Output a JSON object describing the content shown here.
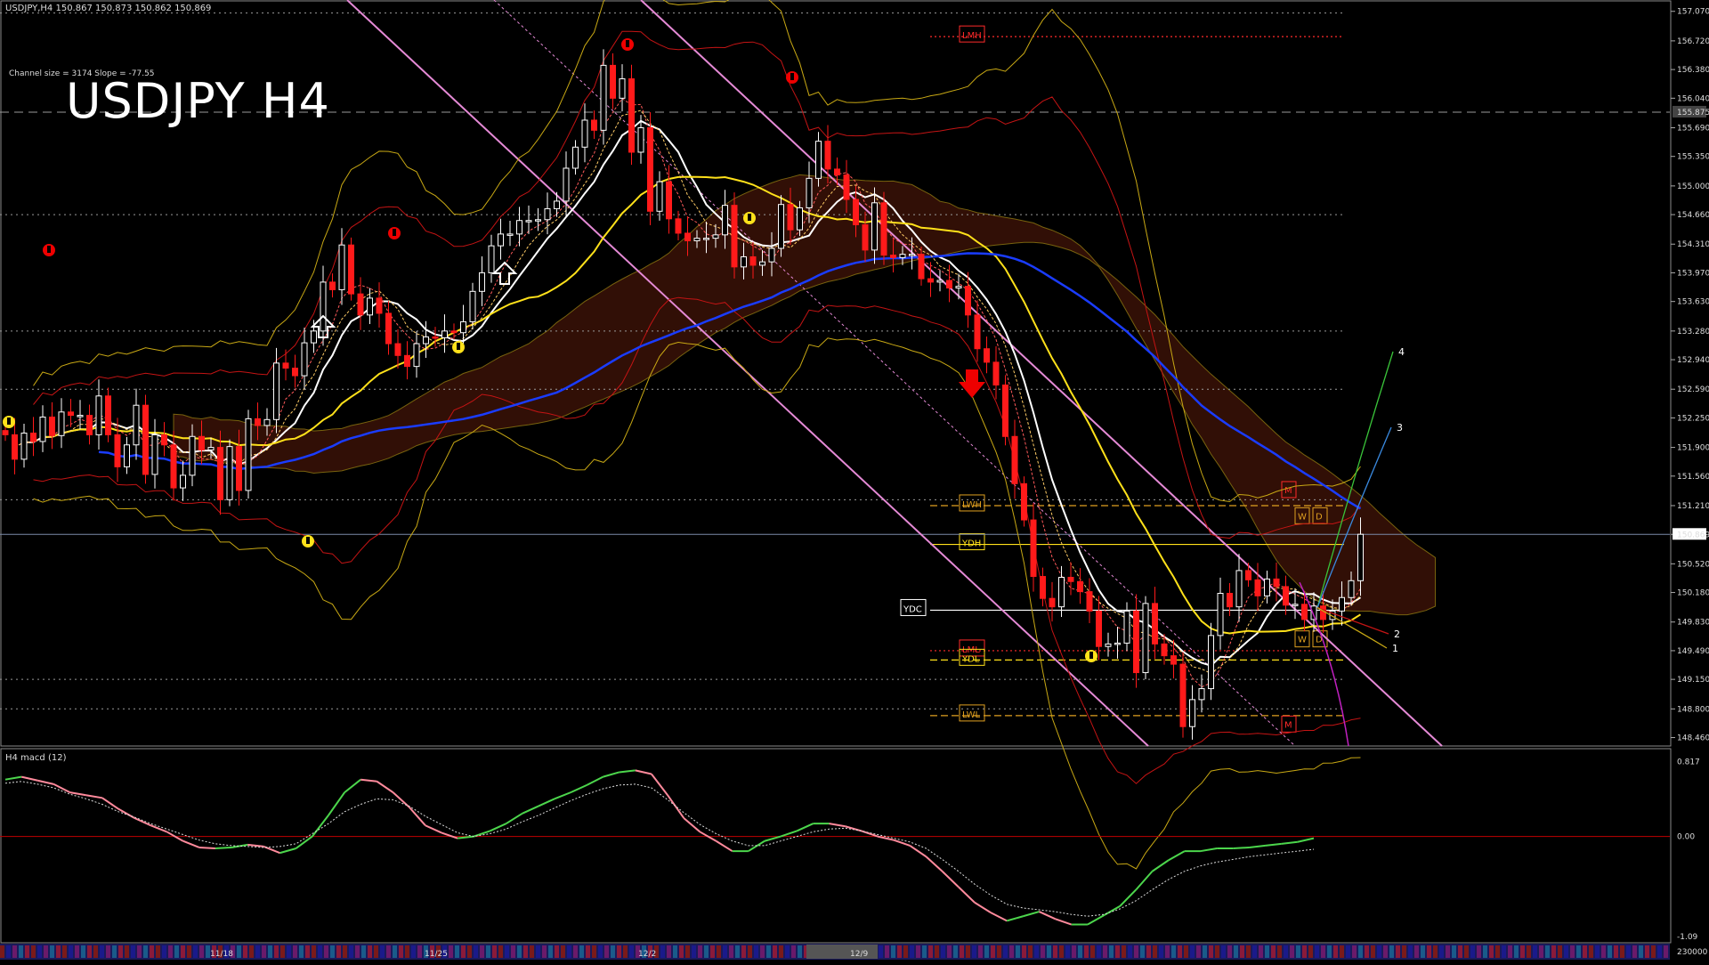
{
  "header": {
    "symbol_line": "USDJPY,H4  150.867 150.873 150.862 150.869",
    "channel_info": "Channel size = 3174 Slope = -77.55",
    "title": "USDJPY H4",
    "macd_label": "H4  macd (12)"
  },
  "colors": {
    "background": "#000000",
    "bull_candle": "#ffffff",
    "bear_candle": "#ff1a1a",
    "channel": "#e58ad6",
    "ma_white": "#ffffff",
    "ma_yellow": "#ffe11a",
    "ma_blue": "#1a3cff",
    "macd_up": "#4cd64c",
    "macd_down": "#ff8a9c",
    "signal": "#dddddd",
    "zero_line": "#c00000"
  },
  "chart_data": [
    {
      "type": "candlestick",
      "title": "USDJPY H4",
      "price_axis": {
        "ticks": [
          "157.070",
          "156.720",
          "156.380",
          "156.040",
          "155.690",
          "155.350",
          "155.000",
          "154.660",
          "154.310",
          "153.970",
          "153.630",
          "153.280",
          "152.940",
          "152.590",
          "152.250",
          "151.900",
          "151.560",
          "151.210",
          "150.869",
          "150.520",
          "150.180",
          "149.830",
          "149.490",
          "149.150",
          "148.800",
          "148.460"
        ],
        "current_price": "150.869",
        "marker_price": "155.875",
        "ylim": [
          148.36,
          157.12
        ]
      },
      "time_axis": {
        "labels": [
          "11/18",
          "11/25",
          "12/2",
          "12/9"
        ]
      },
      "close": [
        152.05,
        151.76,
        152.07,
        151.97,
        152.26,
        152.04,
        152.32,
        152.28,
        152.28,
        152.05,
        152.51,
        152.05,
        151.67,
        151.93,
        152.4,
        151.58,
        152.05,
        151.93,
        151.42,
        151.57,
        152.03,
        151.87,
        151.9,
        151.28,
        151.91,
        151.39,
        152.24,
        152.16,
        152.23,
        152.9,
        152.84,
        152.75,
        153.14,
        153.28,
        153.86,
        153.77,
        154.3,
        153.72,
        153.47,
        153.67,
        153.49,
        153.13,
        152.99,
        152.86,
        153.13,
        153.21,
        153.2,
        153.28,
        153.26,
        153.39,
        153.75,
        153.97,
        154.29,
        154.43,
        154.43,
        154.59,
        154.59,
        154.6,
        154.73,
        154.82,
        155.21,
        155.46,
        155.78,
        155.66,
        156.43,
        156.04,
        156.27,
        155.4,
        155.69,
        154.7,
        155.05,
        154.61,
        154.44,
        154.35,
        154.38,
        154.38,
        154.42,
        154.77,
        154.04,
        154.16,
        154.06,
        154.1,
        154.26,
        154.78,
        154.48,
        154.74,
        155.09,
        155.53,
        155.2,
        155.13,
        154.84,
        154.54,
        154.24,
        154.8,
        154.18,
        154.15,
        154.19,
        154.19,
        153.9,
        153.86,
        153.88,
        153.79,
        153.81,
        153.47,
        153.07,
        152.91,
        152.64,
        152.03,
        151.47,
        151.04,
        150.37,
        150.11,
        150.01,
        150.36,
        150.31,
        150.19,
        149.96,
        149.54,
        149.57,
        149.58,
        149.96,
        149.23,
        150.05,
        149.57,
        149.43,
        149.33,
        148.59,
        148.91,
        149.04,
        149.67,
        150.17,
        150.01,
        150.44,
        150.33,
        150.14,
        150.34,
        150.25,
        150.03,
        150.04,
        149.86,
        150.02,
        149.86,
        149.96,
        150.12,
        150.32,
        150.87
      ],
      "levels": [
        {
          "label": "LMH",
          "price": 156.77,
          "style": "dotted"
        },
        {
          "label": "LWH",
          "price": 151.21,
          "style": "dashed"
        },
        {
          "label": "YDH",
          "price": 150.75,
          "style": "solid"
        },
        {
          "label": "YDC",
          "price": 149.97,
          "style": "solid"
        },
        {
          "label": "LML",
          "price": 149.49,
          "style": "dotted"
        },
        {
          "label": "YDL",
          "price": 149.38,
          "style": "dashed"
        },
        {
          "label": "LWL",
          "price": 148.72,
          "style": "dashed"
        }
      ],
      "period_tags": [
        "W",
        "D",
        "W",
        "D",
        "M",
        "M"
      ],
      "projection_labels": [
        "4",
        "3",
        "2",
        "1"
      ],
      "overlays": [
        "price channel",
        "moving averages",
        "bollinger bands",
        "ichimoku cloud",
        "fractal arrows"
      ]
    },
    {
      "type": "line",
      "title": "H4 macd (12)",
      "y_ticks": [
        "0.817",
        "0.00",
        "-1.09"
      ],
      "secondary_tick": "230000",
      "ylim": [
        -1.12,
        0.85
      ],
      "macd": [
        0.62,
        0.65,
        0.61,
        0.57,
        0.48,
        0.45,
        0.42,
        0.3,
        0.2,
        0.12,
        0.05,
        -0.05,
        -0.12,
        -0.13,
        -0.12,
        -0.09,
        -0.11,
        -0.18,
        -0.13,
        0.0,
        0.23,
        0.48,
        0.62,
        0.6,
        0.48,
        0.32,
        0.12,
        0.04,
        -0.02,
        0.0,
        0.06,
        0.14,
        0.25,
        0.33,
        0.41,
        0.48,
        0.56,
        0.65,
        0.7,
        0.72,
        0.68,
        0.45,
        0.2,
        0.05,
        -0.05,
        -0.16,
        -0.16,
        -0.05,
        0.0,
        0.06,
        0.14,
        0.14,
        0.11,
        0.06,
        0.0,
        -0.04,
        -0.1,
        -0.22,
        -0.38,
        -0.55,
        -0.72,
        -0.83,
        -0.92,
        -0.87,
        -0.82,
        -0.9,
        -0.96,
        -0.96,
        -0.86,
        -0.76,
        -0.58,
        -0.38,
        -0.26,
        -0.16,
        -0.16,
        -0.13,
        -0.13,
        -0.12,
        -0.1,
        -0.08,
        -0.06,
        -0.02
      ],
      "signal": [
        0.58,
        0.6,
        0.57,
        0.53,
        0.46,
        0.41,
        0.35,
        0.27,
        0.21,
        0.14,
        0.08,
        0.02,
        -0.04,
        -0.08,
        -0.1,
        -0.11,
        -0.12,
        -0.11,
        -0.08,
        0.03,
        0.14,
        0.27,
        0.35,
        0.41,
        0.4,
        0.33,
        0.22,
        0.13,
        0.04,
        0.0,
        0.03,
        0.08,
        0.16,
        0.23,
        0.31,
        0.39,
        0.46,
        0.52,
        0.56,
        0.57,
        0.53,
        0.4,
        0.26,
        0.13,
        0.03,
        -0.05,
        -0.1,
        -0.1,
        -0.05,
        0.0,
        0.05,
        0.08,
        0.09,
        0.06,
        0.02,
        -0.02,
        -0.06,
        -0.13,
        -0.25,
        -0.38,
        -0.52,
        -0.64,
        -0.74,
        -0.78,
        -0.8,
        -0.82,
        -0.85,
        -0.87,
        -0.85,
        -0.79,
        -0.7,
        -0.58,
        -0.47,
        -0.38,
        -0.32,
        -0.28,
        -0.25,
        -0.22,
        -0.2,
        -0.18,
        -0.16,
        -0.14
      ]
    }
  ]
}
